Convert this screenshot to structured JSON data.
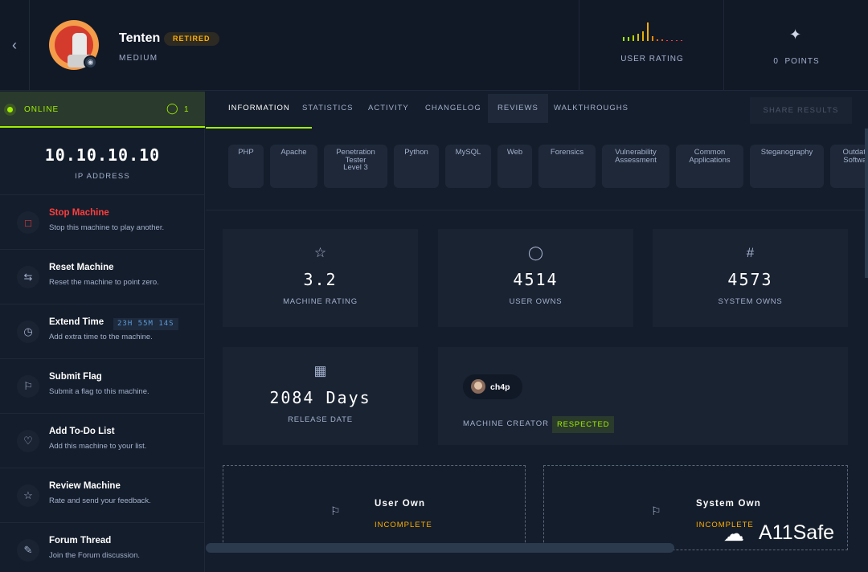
{
  "header": {
    "back_icon": "chevron-left-icon",
    "machine_name": "Tenten",
    "status_badge": "RETIRED",
    "difficulty": "MEDIUM",
    "user_rating_label": "USER RATING",
    "points_value": "0",
    "points_label": "POINTS"
  },
  "sidebar": {
    "status": "ONLINE",
    "players_count": "1",
    "ip": "10.10.10.10",
    "ip_label": "IP ADDRESS",
    "actions": [
      {
        "title": "Stop Machine",
        "desc": "Stop this machine to play another.",
        "icon": "stop-icon"
      },
      {
        "title": "Reset Machine",
        "desc": "Reset the machine to point zero.",
        "icon": "reset-icon"
      },
      {
        "title": "Extend Time",
        "desc": "Add extra time to the machine.",
        "icon": "clock-icon",
        "timer": "23H 55M 14S"
      },
      {
        "title": "Submit Flag",
        "desc": "Submit a flag to this machine.",
        "icon": "flag-icon"
      },
      {
        "title": "Add To-Do List",
        "desc": "Add this machine to your list.",
        "icon": "heart-icon"
      },
      {
        "title": "Review Machine",
        "desc": "Rate and send your feedback.",
        "icon": "star-icon"
      },
      {
        "title": "Forum Thread",
        "desc": "Join the Forum discussion.",
        "icon": "forum-icon"
      }
    ]
  },
  "tabs": [
    "INFORMATION",
    "STATISTICS",
    "ACTIVITY",
    "CHANGELOG",
    "REVIEWS",
    "WALKTHROUGHS"
  ],
  "share_label": "SHARE RESULTS",
  "tags": [
    "PHP",
    "Apache",
    "Penetration\nTester\nLevel 3",
    "Python",
    "MySQL",
    "Web",
    "Forensics",
    "Vulnerability\nAssessment",
    "Common\nApplications",
    "Steganography",
    "Outdated\nSoftware"
  ],
  "stats": {
    "rating": {
      "value": "3.2",
      "label": "MACHINE RATING",
      "icon": "star-icon"
    },
    "user_owns": {
      "value": "4514",
      "label": "USER OWNS",
      "icon": "user-icon"
    },
    "system_owns": {
      "value": "4573",
      "label": "SYSTEM OWNS",
      "icon": "hash-icon"
    },
    "release": {
      "value": "2084 Days",
      "label": "RELEASE DATE",
      "icon": "calendar-icon"
    }
  },
  "creator": {
    "name": "ch4p",
    "label": "MACHINE CREATOR",
    "badge": "RESPECTED"
  },
  "owns": {
    "user": {
      "title": "User Own",
      "status": "INCOMPLETE"
    },
    "system": {
      "title": "System Own",
      "status": "INCOMPLETE"
    }
  },
  "watermark": "A11Safe",
  "colors": {
    "background": "#141d2b",
    "panel": "#1a2332",
    "accent_green": "#9fef00",
    "accent_orange": "#ffaf00",
    "accent_red": "#ff3e3e"
  }
}
